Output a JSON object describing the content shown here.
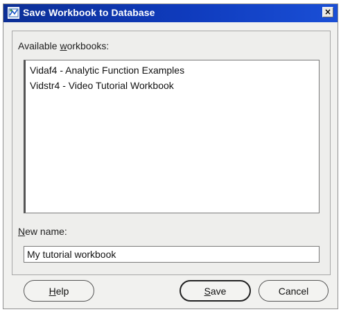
{
  "window": {
    "title": "Save Workbook to Database",
    "close_glyph": "×",
    "icon": "excel-database-icon"
  },
  "available": {
    "label_pre": "Available ",
    "label_mnemonic": "w",
    "label_post": "orkbooks:",
    "items": [
      {
        "label": "Vidaf4 - Analytic Function Examples"
      },
      {
        "label": "Vidstr4 - Video Tutorial Workbook"
      }
    ]
  },
  "new_name": {
    "label_mnemonic": "N",
    "label_post": "ew name:",
    "value": "My tutorial workbook"
  },
  "buttons": {
    "help": {
      "mnemonic": "H",
      "rest": "elp"
    },
    "save": {
      "mnemonic": "S",
      "rest": "ave"
    },
    "cancel": {
      "label": "Cancel"
    }
  }
}
